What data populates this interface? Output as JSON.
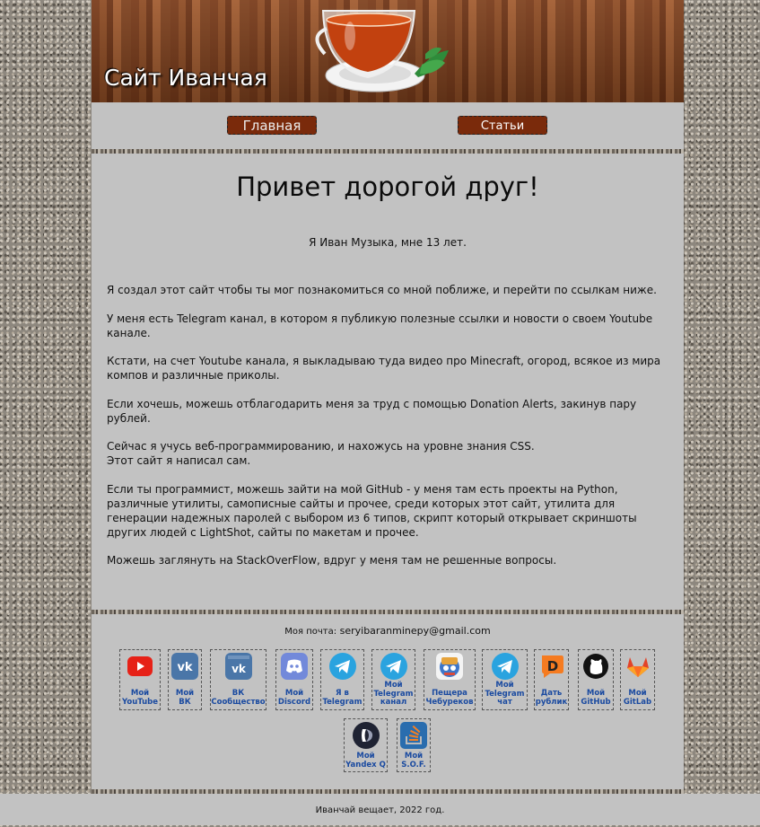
{
  "header": {
    "title": "Сайт Иванчая"
  },
  "nav": {
    "home": "Главная",
    "articles": "Статьи"
  },
  "content": {
    "heading": "Привет дорогой друг!",
    "intro": "Я Иван Музыка, мне 13 лет.",
    "paragraphs": [
      [
        "Я создал этот сайт чтобы ты мог познакомиться со мной поближе, и перейти по ссылкам ниже."
      ],
      [
        "У меня есть Telegram канал, в котором я публикую полезные ссылки и новости о своем Youtube канале."
      ],
      [
        "Кстати, на счет Youtube канала, я выкладываю туда видео про Minecraft, огород, всякое из мира компов и различные приколы."
      ],
      [
        "Если хочешь, можешь отблагодарить меня за труд с помощью Donation Alerts, закинув пару рублей."
      ],
      [
        "Сейчас я учусь веб-программированию, и нахожусь на уровне знания CSS.",
        "Этот сайт я написал сам."
      ],
      [
        "Если ты программист, можешь зайти на мой GitHub - у меня там есть проекты на Python, различные утилиты, самописные сайты и прочее, среди которых этот сайт, утилита для генерации надежных паролей с выбором из 6 типов, скрипт который открывает скриншоты других людей с LightShot, сайты по макетам и прочее."
      ],
      [
        "Можешь заглянуть на StackOverFlow, вдруг у меня там не решенные вопросы."
      ]
    ]
  },
  "footer": {
    "email_label": "Моя почта:",
    "email": "seryibaranminepy@gmail.com",
    "links": [
      {
        "name": "youtube",
        "icon": "youtube-icon",
        "lines": [
          "Мой",
          "YouTube"
        ],
        "color": "#e62117"
      },
      {
        "name": "vk",
        "icon": "vk-icon",
        "lines": [
          "Мой",
          "ВК"
        ],
        "color": "#4a76a8"
      },
      {
        "name": "vk-community",
        "icon": "vk-community-icon",
        "lines": [
          "ВК",
          "Сообщество"
        ],
        "color": "#4a76a8"
      },
      {
        "name": "discord",
        "icon": "discord-icon",
        "lines": [
          "Мой",
          "Discord"
        ],
        "color": "#7289da"
      },
      {
        "name": "telegram-me",
        "icon": "telegram-icon",
        "lines": [
          "Я в",
          "Telegram"
        ],
        "color": "#2aa3df"
      },
      {
        "name": "telegram-channel",
        "icon": "telegram-icon",
        "lines": [
          "Мой",
          "Telegram",
          "канал"
        ],
        "color": "#2aa3df"
      },
      {
        "name": "cheburek-cave",
        "icon": "cheburek-icon",
        "lines": [
          "Пещера",
          "Чебуреков"
        ],
        "color": "#e8e8e8"
      },
      {
        "name": "telegram-chat",
        "icon": "telegram-icon",
        "lines": [
          "Мой",
          "Telegram",
          "чат"
        ],
        "color": "#2aa3df"
      },
      {
        "name": "donate",
        "icon": "donation-alerts-icon",
        "lines": [
          "Дать",
          "рублик"
        ],
        "color": "#f57b20"
      },
      {
        "name": "github",
        "icon": "github-icon",
        "lines": [
          "Мой",
          "GitHub"
        ],
        "color": "#111111"
      },
      {
        "name": "gitlab",
        "icon": "gitlab-icon",
        "lines": [
          "Мой",
          "GitLab"
        ],
        "color": "#e24329"
      },
      {
        "name": "yandex-q",
        "icon": "yandex-q-icon",
        "lines": [
          "Мой",
          "Yandex Q"
        ],
        "color": "#1f2333"
      },
      {
        "name": "stackoverflow",
        "icon": "stackoverflow-icon",
        "lines": [
          "Мой",
          "S.O.F."
        ],
        "color": "#2a6dae"
      }
    ]
  },
  "bottom": {
    "copyright": "Иванчай вещает, 2022 год."
  }
}
